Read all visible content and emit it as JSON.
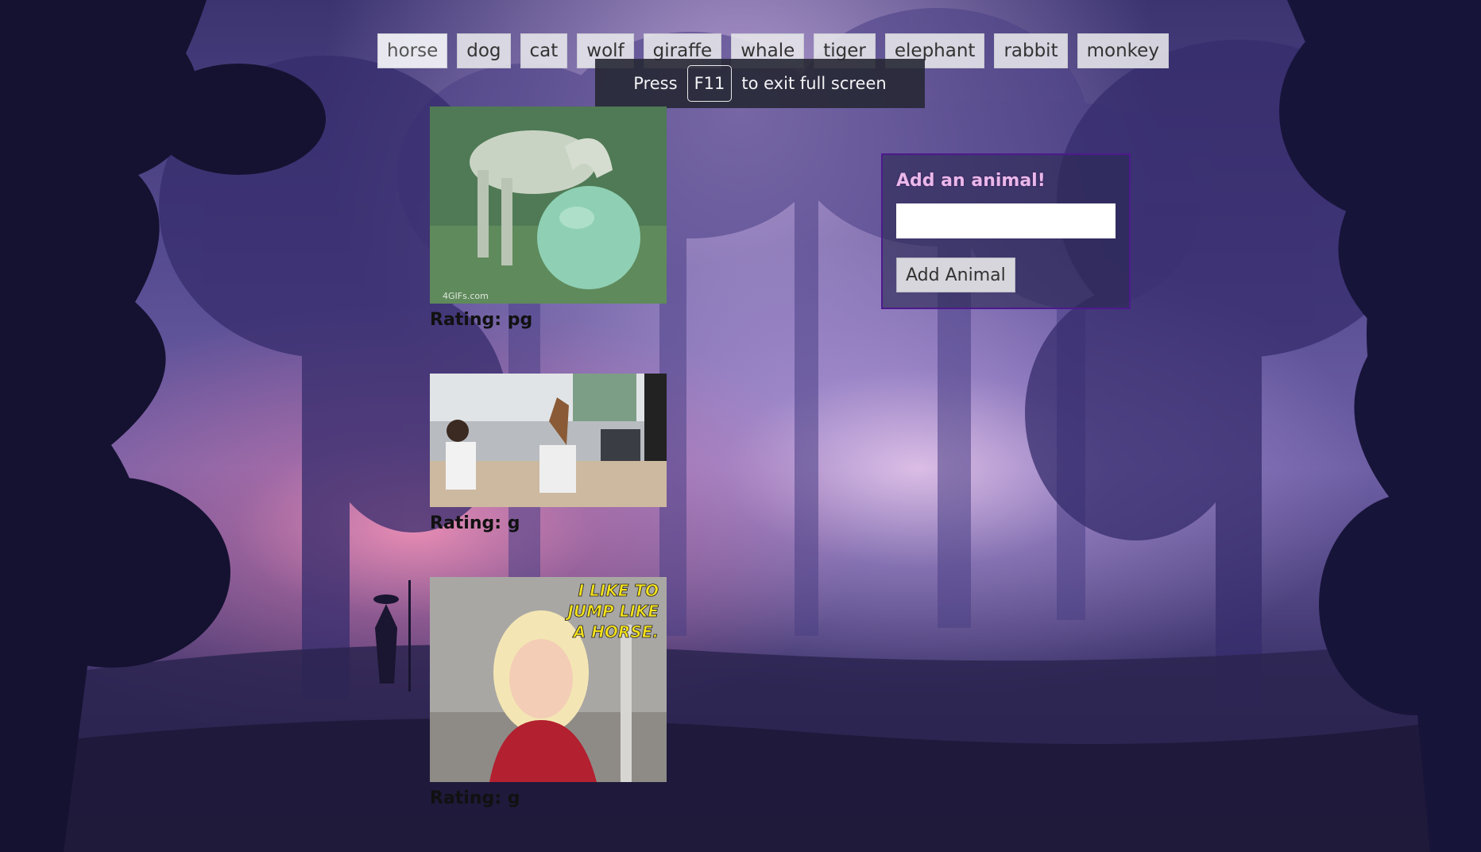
{
  "animals": [
    "horse",
    "dog",
    "cat",
    "wolf",
    "giraffe",
    "whale",
    "tiger",
    "elephant",
    "rabbit",
    "monkey"
  ],
  "fullscreen_notice": {
    "before": "Press",
    "key": "F11",
    "after": "to exit full screen"
  },
  "gifs": [
    {
      "rating": "Rating: pg",
      "watermark": "4GIFs.com"
    },
    {
      "rating": "Rating: g"
    },
    {
      "rating": "Rating: g",
      "caption_lines": [
        "I LIKE TO",
        "JUMP LIKE",
        "A HORSE."
      ]
    }
  ],
  "form": {
    "title": "Add an animal!",
    "input_value": "",
    "button_label": "Add Animal"
  }
}
